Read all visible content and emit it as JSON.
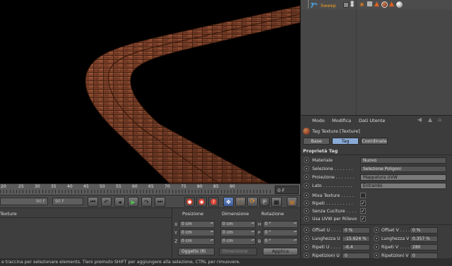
{
  "timeline": {
    "ticks": [
      "20",
      "25",
      "30",
      "35",
      "40",
      "45",
      "50",
      "55",
      "60",
      "65",
      "70",
      "75",
      "80",
      "85",
      "90"
    ],
    "current_frame": "0 F"
  },
  "transport": {
    "range_start": "90 F",
    "range_end": "90 F"
  },
  "material_panel": {
    "header": "Texture"
  },
  "coordinates": {
    "headers": {
      "position": "Posizione",
      "size": "Dimensione",
      "rotation": "Rotazione"
    },
    "rows": [
      {
        "axis": "X",
        "pos": "0 cm",
        "size": "0 cm",
        "rot_axis": "H",
        "rot": "0 °"
      },
      {
        "axis": "Y",
        "pos": "0 cm",
        "size": "0 cm",
        "rot_axis": "P",
        "rot": "0 °"
      },
      {
        "axis": "Z",
        "pos": "0 cm",
        "size": "0 cm",
        "rot_axis": "B",
        "rot": "0 °"
      }
    ],
    "mode_select": "Oggetto (Ri",
    "size_select": "Dimensione",
    "apply_label": "Applica"
  },
  "status_bar": "e traccina per selezionare elements. Tieni premuto SHIFT per aggiungere alla selezione, CTRL per rimuovere.",
  "object_manager": {
    "object_name": "Sweep"
  },
  "attributes": {
    "menu": {
      "mode": "Modo",
      "edit": "Modifica",
      "user_data": "Dati Utente"
    },
    "title": "Tag Texture [Texture]",
    "tabs": {
      "base": "Base",
      "tag": "Tag",
      "coords": "Coordinate"
    },
    "section": "Proprietà Tag",
    "material_label": "Materiale",
    "material_value": "Nuovo",
    "selection_label": "Selezione . . . . . . .",
    "selection_value": "Selezione Poligoni",
    "projection_label": "Proiezione . . . . . . .",
    "projection_value": "Mappatura UVW",
    "side_label": "Lato . . . . . . . . . . .",
    "side_value": "Entrambi",
    "checks": [
      {
        "label": "Mixa Texture . . . . .",
        "checked": false
      },
      {
        "label": "Ripeti . . . . . . . . . .",
        "checked": true
      },
      {
        "label": "Senza Cuciture . . . .",
        "checked": true
      },
      {
        "label": "Usa UVW per Rilievo",
        "checked": true
      }
    ],
    "params": [
      {
        "left_label": "Offset U . . . .",
        "left_value": "0 %",
        "right_label": "Offset V . . . .",
        "right_value": "0 %"
      },
      {
        "left_label": "Lunghezza U .",
        "left_value": "-15.624 %",
        "right_label": "Lunghezza V .",
        "right_value": "0.357 %"
      },
      {
        "left_label": "Ripeti U . . . .",
        "left_value": "-6.4",
        "right_label": "Ripeti V . . . .",
        "right_value": "280"
      },
      {
        "left_label": "Ripetizioni U",
        "left_value": "0",
        "right_label": "Ripetizioni V",
        "right_value": "0"
      }
    ]
  }
}
